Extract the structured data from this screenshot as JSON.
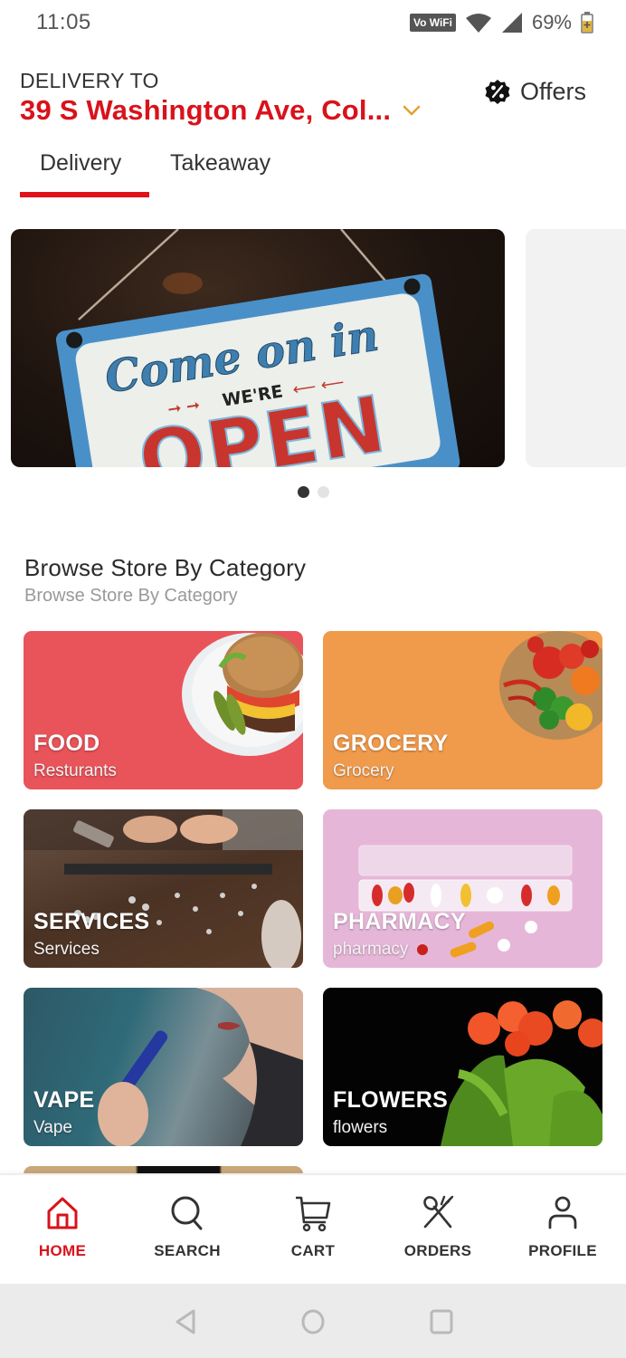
{
  "status_bar": {
    "time": "11:05",
    "vowifi_label": "Vo WiFi",
    "battery_percent": "69%",
    "icons": [
      "vowifi-icon",
      "wifi-icon",
      "cell-signal-icon",
      "battery-charging-icon"
    ]
  },
  "header": {
    "delivery_label": "DELIVERY TO",
    "address": "39 S Washington Ave, Col...",
    "address_icon": "chevron-down-icon",
    "offers_label": "Offers",
    "offers_icon": "percent-badge-icon"
  },
  "tabs": [
    {
      "label": "Delivery",
      "active": true
    },
    {
      "label": "Takeaway",
      "active": false
    }
  ],
  "carousel": {
    "banner_text": {
      "line1": "Come on in",
      "line2": "WE'RE",
      "line3": "OPEN"
    },
    "page_count": 2,
    "active_page": 1
  },
  "section": {
    "title": "Browse Store By Category",
    "subtitle": "Browse Store By Category"
  },
  "categories": [
    {
      "title": "FOOD",
      "subtitle": "Resturants",
      "color": "#e9535a"
    },
    {
      "title": "GROCERY",
      "subtitle": "Grocery",
      "color": "#f09a4b"
    },
    {
      "title": "SERVICES",
      "subtitle": "Services"
    },
    {
      "title": "PHARMACY",
      "subtitle": "pharmacy",
      "color": "#e6b6d8"
    },
    {
      "title": "VAPE",
      "subtitle": "Vape"
    },
    {
      "title": "FLOWERS",
      "subtitle": "flowers",
      "color": "#030303"
    }
  ],
  "bottom_nav": [
    {
      "label": "HOME",
      "icon": "home-icon",
      "active": true
    },
    {
      "label": "SEARCH",
      "icon": "search-icon",
      "active": false
    },
    {
      "label": "CART",
      "icon": "cart-icon",
      "active": false
    },
    {
      "label": "ORDERS",
      "icon": "fork-spoon-icon",
      "active": false
    },
    {
      "label": "PROFILE",
      "icon": "person-icon",
      "active": false
    }
  ],
  "colors": {
    "brand_red": "#d9121b",
    "chevron_orange": "#e8a030",
    "text_dark": "#333333",
    "text_muted": "#999999"
  }
}
